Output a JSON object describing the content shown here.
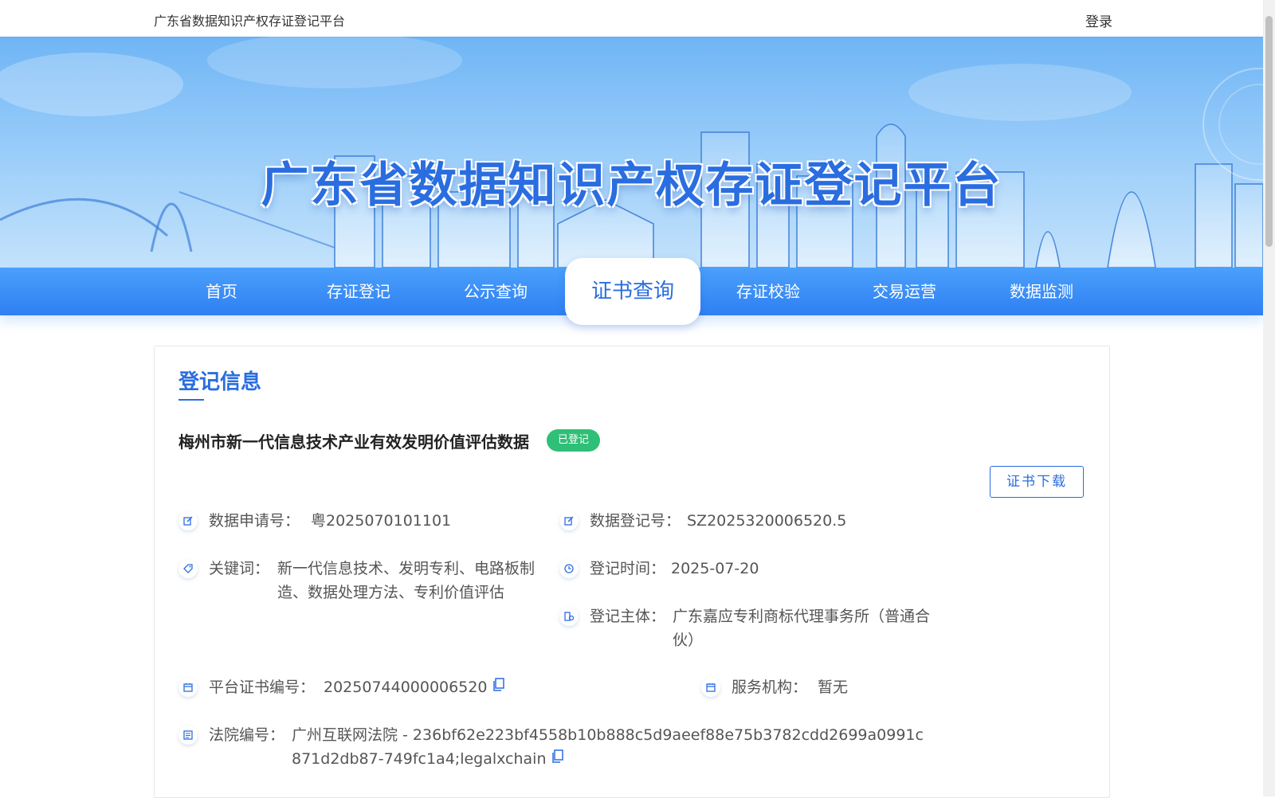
{
  "header": {
    "site_title": "广东省数据知识产权存证登记平台",
    "login": "登录"
  },
  "banner": {
    "title": "广东省数据知识产权存证登记平台"
  },
  "nav": {
    "items": [
      {
        "label": "首页"
      },
      {
        "label": "存证登记"
      },
      {
        "label": "公示查询"
      },
      {
        "label": "证书查询",
        "active": true
      },
      {
        "label": "存证校验"
      },
      {
        "label": "交易运营"
      },
      {
        "label": "数据监测"
      }
    ]
  },
  "registration": {
    "section_title": "登记信息",
    "item_title": "梅州市新一代信息技术产业有效发明价值评估数据",
    "status": "已登记",
    "download_label": "证书下载",
    "fields": {
      "application_no_label": "数据申请号：",
      "application_no": "粤2025070101101",
      "registration_no_label": "数据登记号：",
      "registration_no": "SZ2025320006520.5",
      "keywords_label": "关键词：",
      "keywords": "新一代信息技术、发明专利、电路板制造、数据处理方法、专利价值评估",
      "reg_time_label": "登记时间：",
      "reg_time": "2025-07-20",
      "subject_label": "登记主体：",
      "subject": "广东嘉应专利商标代理事务所（普通合伙）",
      "cert_no_label": "平台证书编号：",
      "cert_no": "20250744000006520",
      "service_org_label": "服务机构：",
      "service_org": "暂无",
      "court_no_label": "法院编号：",
      "court_no": "广州互联网法院 - 236bf62e223bf4558b10b888c5d9aeef88e75b3782cdd2699a0991c871d2db87-749fc1a4;legalxchain"
    }
  },
  "icons": {
    "edit": "edit-icon",
    "tag": "tag-icon",
    "clock": "clock-icon",
    "entity": "entity-icon",
    "calendar": "calendar-icon",
    "document": "document-icon",
    "copy": "copy-icon"
  },
  "colors": {
    "primary": "#2a6de0",
    "nav_top": "#4aa0fb",
    "nav_bottom": "#2f7ff3",
    "status_green": "#2fbf77"
  }
}
